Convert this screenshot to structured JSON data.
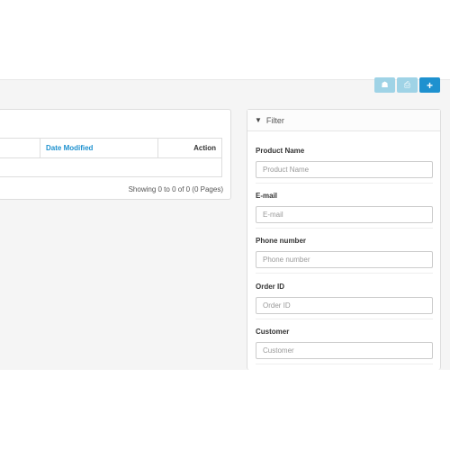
{
  "toolbar": {
    "icons": [
      "home-icon",
      "print-icon",
      "plus-icon"
    ],
    "colors": {
      "light": "#9fd3e6",
      "primary": "#1e91cf"
    }
  },
  "list": {
    "headers": {
      "date_modified": "Date Modified",
      "action": "Action"
    },
    "showing": "Showing 0 to 0 of 0 (0 Pages)"
  },
  "filter": {
    "title": "Filter",
    "fields": [
      {
        "label": "Product Name",
        "placeholder": "Product Name"
      },
      {
        "label": "E-mail",
        "placeholder": "E-mail"
      },
      {
        "label": "Phone number",
        "placeholder": "Phone number"
      },
      {
        "label": "Order ID",
        "placeholder": "Order ID"
      },
      {
        "label": "Customer",
        "placeholder": "Customer"
      }
    ]
  }
}
